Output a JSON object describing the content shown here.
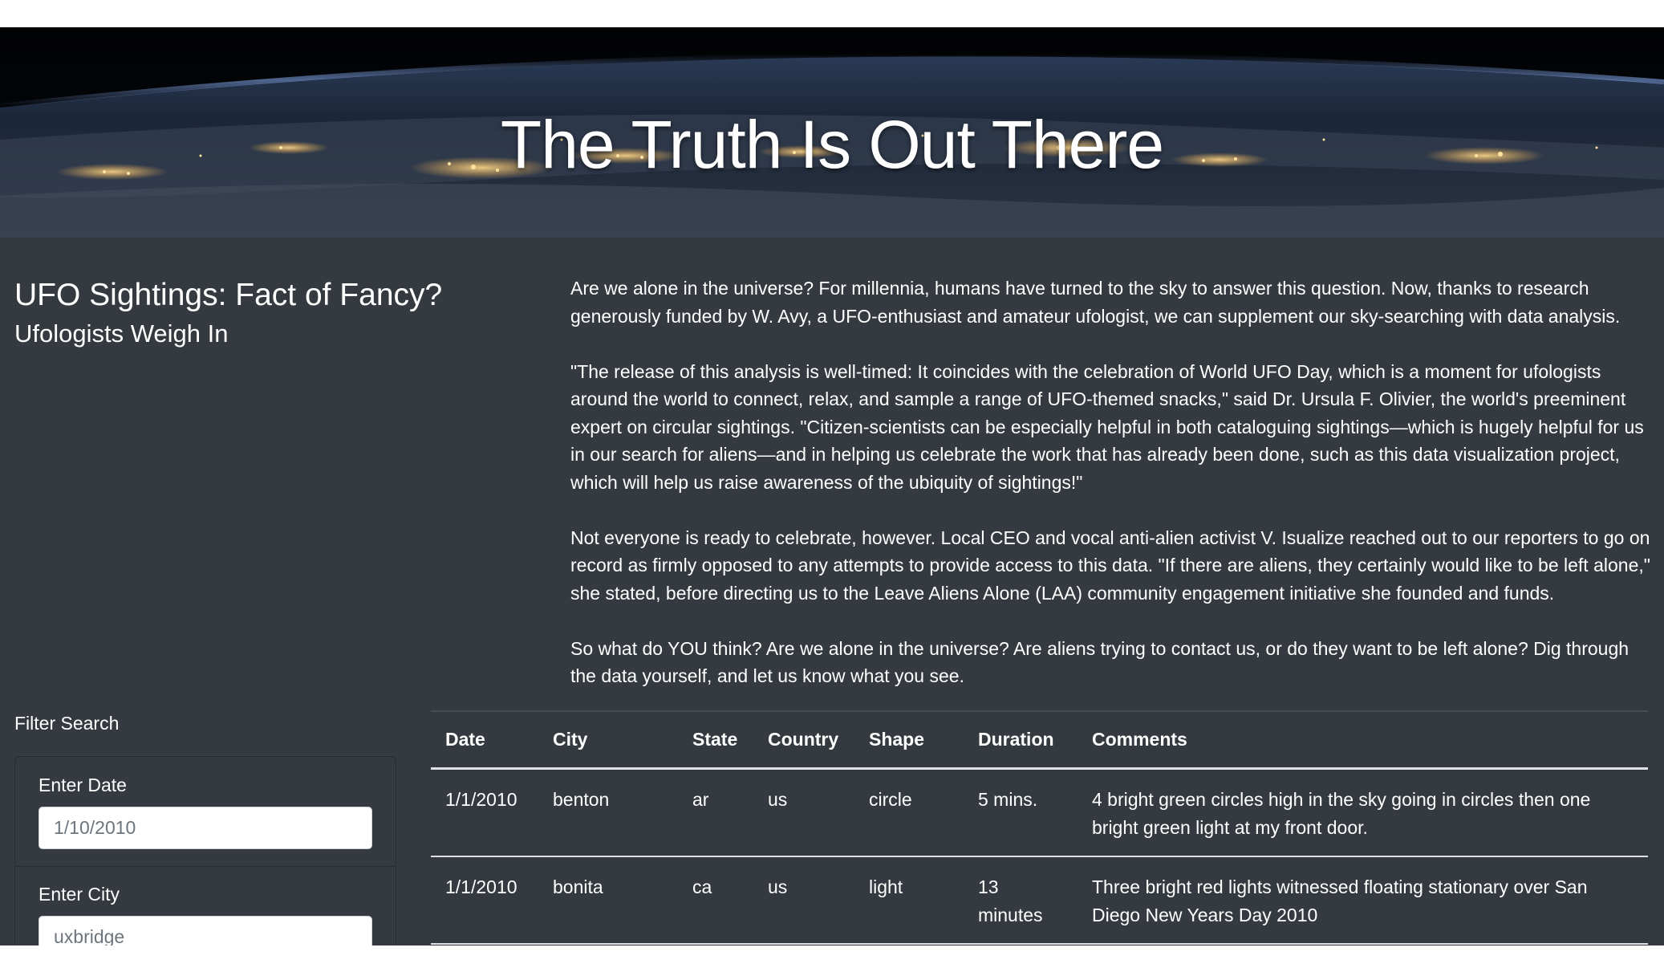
{
  "hero": {
    "title": "The Truth Is Out There"
  },
  "intro": {
    "headline": "UFO Sightings: Fact of Fancy?",
    "subheadline": "Ufologists Weigh In"
  },
  "article": {
    "paragraphs": [
      "Are we alone in the universe? For millennia, humans have turned to the sky to answer this question. Now, thanks to research generously funded by W. Avy, a UFO-enthusiast and amateur ufologist, we can supplement our sky-searching with data analysis.",
      "\"The release of this analysis is well-timed: It coincides with the celebration of World UFO Day, which is a moment for ufologists around the world to connect, relax, and sample a range of UFO-themed snacks,\" said Dr. Ursula F. Olivier, the world's preeminent expert on circular sightings. \"Citizen-scientists can be especially helpful in both cataloguing sightings—which is hugely helpful for us in our search for aliens—and in helping us celebrate the work that has already been done, such as this data visualization project, which will help us raise awareness of the ubiquity of sightings!\"",
      "Not everyone is ready to celebrate, however. Local CEO and vocal anti-alien activist V. Isualize reached out to our reporters to go on record as firmly opposed to any attempts to provide access to this data. \"If there are aliens, they certainly would like to be left alone,\" she stated, before directing us to the Leave Aliens Alone (LAA) community engagement initiative she founded and funds.",
      "So what do YOU think? Are we alone in the universe? Are aliens trying to contact us, or do they want to be left alone? Dig through the data yourself, and let us know what you see."
    ]
  },
  "filter": {
    "title": "Filter Search",
    "date_label": "Enter Date",
    "date_placeholder": "1/10/2010",
    "city_label": "Enter City",
    "city_placeholder": "uxbridge"
  },
  "table": {
    "headers": [
      "Date",
      "City",
      "State",
      "Country",
      "Shape",
      "Duration",
      "Comments"
    ],
    "rows": [
      {
        "date": "1/1/2010",
        "city": "benton",
        "state": "ar",
        "country": "us",
        "shape": "circle",
        "duration": "5 mins.",
        "comments": "4 bright green circles high in the sky going in circles then one bright green light at my front door."
      },
      {
        "date": "1/1/2010",
        "city": "bonita",
        "state": "ca",
        "country": "us",
        "shape": "light",
        "duration": "13 minutes",
        "comments": "Three bright red lights witnessed floating stationary over San Diego New Years Day 2010"
      }
    ]
  },
  "colors": {
    "body_background": "#343a40",
    "hero_background": "#05070b",
    "text": "#ffffff",
    "table_border": "#dee2e6",
    "city_lights": "#f6c86a"
  }
}
